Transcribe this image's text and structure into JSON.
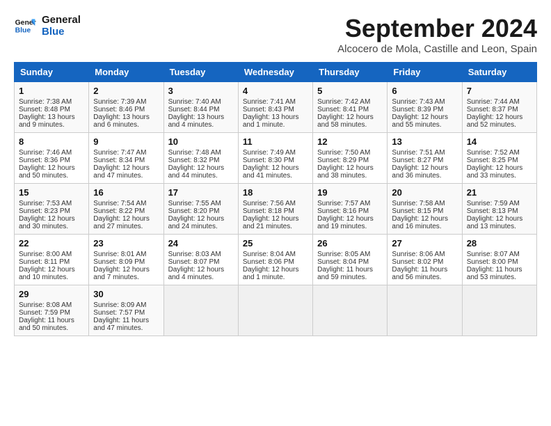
{
  "header": {
    "logo_line1": "General",
    "logo_line2": "Blue",
    "month": "September 2024",
    "location": "Alcocero de Mola, Castille and Leon, Spain"
  },
  "columns": [
    "Sunday",
    "Monday",
    "Tuesday",
    "Wednesday",
    "Thursday",
    "Friday",
    "Saturday"
  ],
  "weeks": [
    [
      {
        "day": "1",
        "lines": [
          "Sunrise: 7:38 AM",
          "Sunset: 8:48 PM",
          "Daylight: 13 hours",
          "and 9 minutes."
        ]
      },
      {
        "day": "2",
        "lines": [
          "Sunrise: 7:39 AM",
          "Sunset: 8:46 PM",
          "Daylight: 13 hours",
          "and 6 minutes."
        ]
      },
      {
        "day": "3",
        "lines": [
          "Sunrise: 7:40 AM",
          "Sunset: 8:44 PM",
          "Daylight: 13 hours",
          "and 4 minutes."
        ]
      },
      {
        "day": "4",
        "lines": [
          "Sunrise: 7:41 AM",
          "Sunset: 8:43 PM",
          "Daylight: 13 hours",
          "and 1 minute."
        ]
      },
      {
        "day": "5",
        "lines": [
          "Sunrise: 7:42 AM",
          "Sunset: 8:41 PM",
          "Daylight: 12 hours",
          "and 58 minutes."
        ]
      },
      {
        "day": "6",
        "lines": [
          "Sunrise: 7:43 AM",
          "Sunset: 8:39 PM",
          "Daylight: 12 hours",
          "and 55 minutes."
        ]
      },
      {
        "day": "7",
        "lines": [
          "Sunrise: 7:44 AM",
          "Sunset: 8:37 PM",
          "Daylight: 12 hours",
          "and 52 minutes."
        ]
      }
    ],
    [
      {
        "day": "8",
        "lines": [
          "Sunrise: 7:46 AM",
          "Sunset: 8:36 PM",
          "Daylight: 12 hours",
          "and 50 minutes."
        ]
      },
      {
        "day": "9",
        "lines": [
          "Sunrise: 7:47 AM",
          "Sunset: 8:34 PM",
          "Daylight: 12 hours",
          "and 47 minutes."
        ]
      },
      {
        "day": "10",
        "lines": [
          "Sunrise: 7:48 AM",
          "Sunset: 8:32 PM",
          "Daylight: 12 hours",
          "and 44 minutes."
        ]
      },
      {
        "day": "11",
        "lines": [
          "Sunrise: 7:49 AM",
          "Sunset: 8:30 PM",
          "Daylight: 12 hours",
          "and 41 minutes."
        ]
      },
      {
        "day": "12",
        "lines": [
          "Sunrise: 7:50 AM",
          "Sunset: 8:29 PM",
          "Daylight: 12 hours",
          "and 38 minutes."
        ]
      },
      {
        "day": "13",
        "lines": [
          "Sunrise: 7:51 AM",
          "Sunset: 8:27 PM",
          "Daylight: 12 hours",
          "and 36 minutes."
        ]
      },
      {
        "day": "14",
        "lines": [
          "Sunrise: 7:52 AM",
          "Sunset: 8:25 PM",
          "Daylight: 12 hours",
          "and 33 minutes."
        ]
      }
    ],
    [
      {
        "day": "15",
        "lines": [
          "Sunrise: 7:53 AM",
          "Sunset: 8:23 PM",
          "Daylight: 12 hours",
          "and 30 minutes."
        ]
      },
      {
        "day": "16",
        "lines": [
          "Sunrise: 7:54 AM",
          "Sunset: 8:22 PM",
          "Daylight: 12 hours",
          "and 27 minutes."
        ]
      },
      {
        "day": "17",
        "lines": [
          "Sunrise: 7:55 AM",
          "Sunset: 8:20 PM",
          "Daylight: 12 hours",
          "and 24 minutes."
        ]
      },
      {
        "day": "18",
        "lines": [
          "Sunrise: 7:56 AM",
          "Sunset: 8:18 PM",
          "Daylight: 12 hours",
          "and 21 minutes."
        ]
      },
      {
        "day": "19",
        "lines": [
          "Sunrise: 7:57 AM",
          "Sunset: 8:16 PM",
          "Daylight: 12 hours",
          "and 19 minutes."
        ]
      },
      {
        "day": "20",
        "lines": [
          "Sunrise: 7:58 AM",
          "Sunset: 8:15 PM",
          "Daylight: 12 hours",
          "and 16 minutes."
        ]
      },
      {
        "day": "21",
        "lines": [
          "Sunrise: 7:59 AM",
          "Sunset: 8:13 PM",
          "Daylight: 12 hours",
          "and 13 minutes."
        ]
      }
    ],
    [
      {
        "day": "22",
        "lines": [
          "Sunrise: 8:00 AM",
          "Sunset: 8:11 PM",
          "Daylight: 12 hours",
          "and 10 minutes."
        ]
      },
      {
        "day": "23",
        "lines": [
          "Sunrise: 8:01 AM",
          "Sunset: 8:09 PM",
          "Daylight: 12 hours",
          "and 7 minutes."
        ]
      },
      {
        "day": "24",
        "lines": [
          "Sunrise: 8:03 AM",
          "Sunset: 8:07 PM",
          "Daylight: 12 hours",
          "and 4 minutes."
        ]
      },
      {
        "day": "25",
        "lines": [
          "Sunrise: 8:04 AM",
          "Sunset: 8:06 PM",
          "Daylight: 12 hours",
          "and 1 minute."
        ]
      },
      {
        "day": "26",
        "lines": [
          "Sunrise: 8:05 AM",
          "Sunset: 8:04 PM",
          "Daylight: 11 hours",
          "and 59 minutes."
        ]
      },
      {
        "day": "27",
        "lines": [
          "Sunrise: 8:06 AM",
          "Sunset: 8:02 PM",
          "Daylight: 11 hours",
          "and 56 minutes."
        ]
      },
      {
        "day": "28",
        "lines": [
          "Sunrise: 8:07 AM",
          "Sunset: 8:00 PM",
          "Daylight: 11 hours",
          "and 53 minutes."
        ]
      }
    ],
    [
      {
        "day": "29",
        "lines": [
          "Sunrise: 8:08 AM",
          "Sunset: 7:59 PM",
          "Daylight: 11 hours",
          "and 50 minutes."
        ]
      },
      {
        "day": "30",
        "lines": [
          "Sunrise: 8:09 AM",
          "Sunset: 7:57 PM",
          "Daylight: 11 hours",
          "and 47 minutes."
        ]
      },
      null,
      null,
      null,
      null,
      null
    ]
  ]
}
